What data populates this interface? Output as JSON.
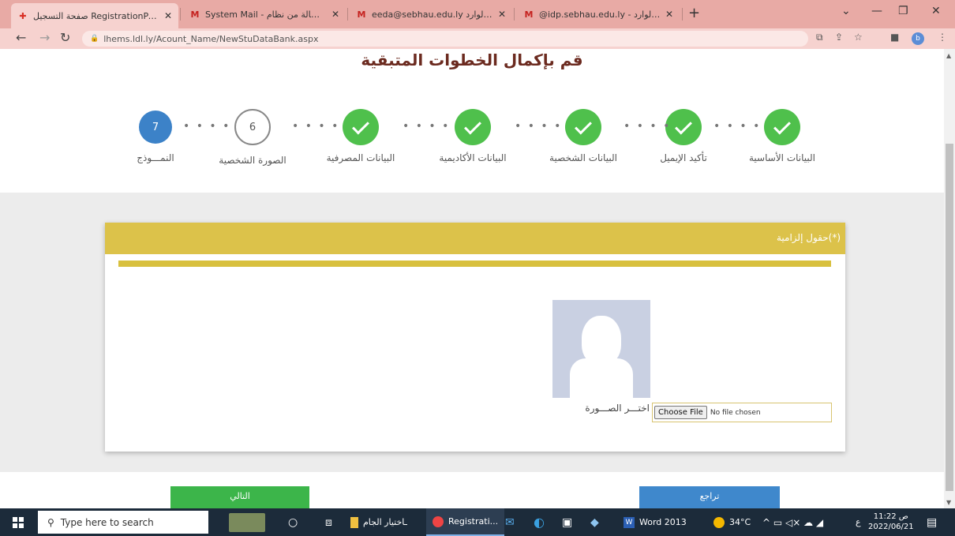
{
  "browser": {
    "tabs": [
      {
        "title": "صفحة التسجيل RegistrationPage",
        "close": "✕"
      },
      {
        "title": "System Mail - رسالة من نظام - h",
        "close": "✕"
      },
      {
        "title": "eeda@sebhau.edu.ly البريد الوارد -",
        "close": "✕"
      },
      {
        "title": "@idp.sebhau.edu.ly - البريد الوارد",
        "close": "✕"
      }
    ],
    "new_tab": "+",
    "url": "lhems.ldl.ly/Acount_Name/NewStuDataBank.aspx",
    "profile_initial": "b"
  },
  "page": {
    "title": "قم بإكمال الخطوات المتبقية",
    "steps": [
      {
        "label": "البيانات الأساسية",
        "state": "done"
      },
      {
        "label": "تأكيد الإيميل",
        "state": "done"
      },
      {
        "label": "البيانات الشخصية",
        "state": "done"
      },
      {
        "label": "البيانات الأكاديمية",
        "state": "done"
      },
      {
        "label": "البيانات المصرفية",
        "state": "done"
      },
      {
        "label": "الصورة الشخصية",
        "number": "6",
        "state": "current"
      },
      {
        "label": "النمـــوذج",
        "number": "7",
        "state": "next"
      }
    ],
    "dots": "• • • •",
    "card": {
      "header": "(*)حقول إلزامية",
      "file_label": "اختـــر الصـــورة",
      "choose_file": "Choose File",
      "no_file": "No file chosen"
    },
    "buttons": {
      "next": "التالي",
      "back": "تراجع"
    }
  },
  "taskbar": {
    "search_placeholder": "Type here to search",
    "items": [
      {
        "label": "ـاختيار الجام"
      },
      {
        "label": "Registrati..."
      },
      {
        "label": "Word 2013"
      }
    ],
    "weather": "34°C",
    "time": "11:22 ص",
    "date": "2022/06/21",
    "lang": "ع"
  },
  "colors": {
    "done": "#4fc04c",
    "next_step": "#3c82c8",
    "card_header": "#dcc24a",
    "title": "#6b2a1f",
    "btn_next": "#3cb54a",
    "btn_back": "#3f88cc"
  }
}
